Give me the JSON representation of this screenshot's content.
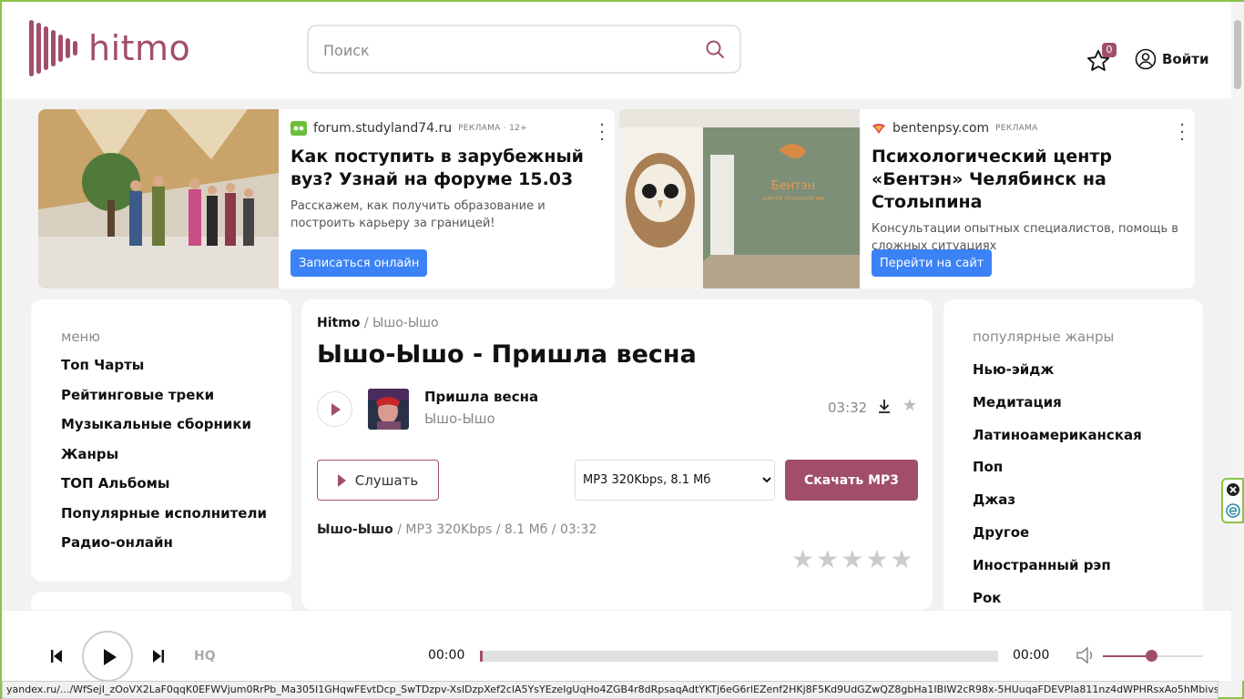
{
  "brand": {
    "logo_text": "hitmo",
    "accent": "#a14f68"
  },
  "search": {
    "placeholder": "Поиск"
  },
  "header": {
    "fav_count": "0",
    "login_label": "Войти"
  },
  "ads": [
    {
      "source": "forum.studyland74.ru",
      "tag": "РЕКЛАМА · 12+",
      "title": "Как поступить в зарубежный вуз? Узнай на форуме 15.03",
      "text": "Расскажем, как получить образование и построить карьеру за границей!",
      "button": "Записаться онлайн"
    },
    {
      "source": "bentenpsy.com",
      "tag": "РЕКЛАМА",
      "title": "Психологический центр «Бентэн» Челябинск на Столыпина",
      "text": "Консультации опытных специалистов, помощь в сложных ситуациях",
      "button": "Перейти на сайт",
      "image_sign": "Бентэн",
      "image_sign_sub": "центр психологии"
    }
  ],
  "menu": {
    "title": "меню",
    "items": [
      "Топ Чарты",
      "Рейтинговые треки",
      "Музыкальные сборники",
      "Жанры",
      "ТОП Альбомы",
      "Популярные исполнители",
      "Радио-онлайн"
    ]
  },
  "breadcrumb": {
    "home": "Hitmo",
    "separator": "/",
    "current": "Ышо-Ышо"
  },
  "page_title": "Ышо-Ышо - Пришла весна",
  "track": {
    "name": "Пришла весна",
    "artist": "Ышо-Ышо",
    "duration": "03:32"
  },
  "actions": {
    "listen": "Слушать",
    "quality_selected": "MP3 320Kbps, 8.1 Мб",
    "download": "Скачать MP3"
  },
  "meta": {
    "artist": "Ышо-Ышо",
    "sep": "/",
    "format": "MP3 320Kbps",
    "size": "8.1 Мб",
    "duration": "03:32"
  },
  "rating": {
    "stars_total": 5,
    "stars_filled": 0
  },
  "genres": {
    "title": "популярные жанры",
    "items": [
      "Нью-эйдж",
      "Медитация",
      "Латиноамериканская",
      "Поп",
      "Джаз",
      "Другое",
      "Иностранный рэп",
      "Рок"
    ]
  },
  "player": {
    "quality": "HQ",
    "current_time": "00:00",
    "total_time": "00:00",
    "progress": 0.005,
    "volume": 0.48
  },
  "status_url": "yandex.ru/.../WfSejI_zOoVX2LaF0qqK0EFWVjum0RrPb_Ma305I1GHqwFEvtDcp_SwTDzpv-XslDzpXef2clA5YsYEzeIgUqHo4ZGB4r8dRpsaqAdtYKTj6eG6rlEZenf2HKj8F5Kd9UdGZwQZ8gbHa1IBIW2cR98x-5HUuqaFDEVPIa811nz4dWPHRsxAo5hMbivsn8_3F..."
}
